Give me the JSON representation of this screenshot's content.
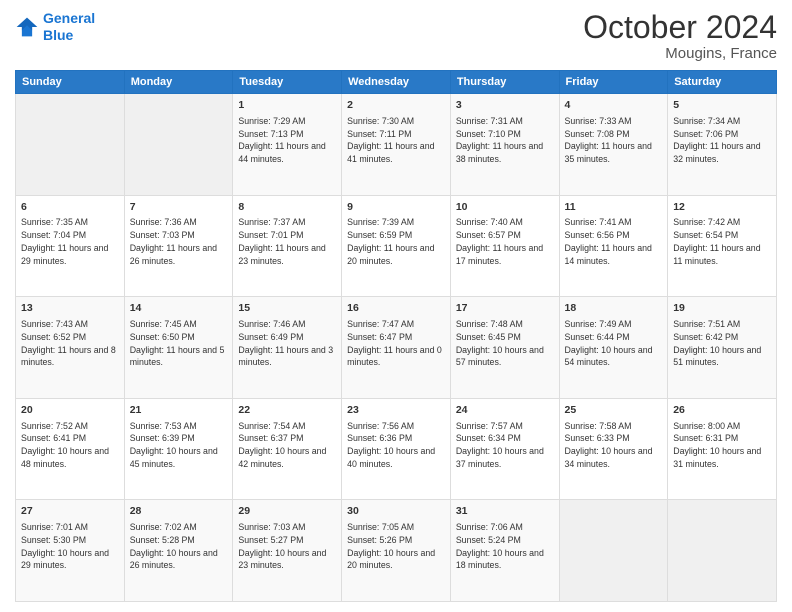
{
  "header": {
    "logo_line1": "General",
    "logo_line2": "Blue",
    "month": "October 2024",
    "location": "Mougins, France"
  },
  "days_of_week": [
    "Sunday",
    "Monday",
    "Tuesday",
    "Wednesday",
    "Thursday",
    "Friday",
    "Saturday"
  ],
  "weeks": [
    [
      {
        "day": "",
        "info": ""
      },
      {
        "day": "",
        "info": ""
      },
      {
        "day": "1",
        "info": "Sunrise: 7:29 AM\nSunset: 7:13 PM\nDaylight: 11 hours and 44 minutes."
      },
      {
        "day": "2",
        "info": "Sunrise: 7:30 AM\nSunset: 7:11 PM\nDaylight: 11 hours and 41 minutes."
      },
      {
        "day": "3",
        "info": "Sunrise: 7:31 AM\nSunset: 7:10 PM\nDaylight: 11 hours and 38 minutes."
      },
      {
        "day": "4",
        "info": "Sunrise: 7:33 AM\nSunset: 7:08 PM\nDaylight: 11 hours and 35 minutes."
      },
      {
        "day": "5",
        "info": "Sunrise: 7:34 AM\nSunset: 7:06 PM\nDaylight: 11 hours and 32 minutes."
      }
    ],
    [
      {
        "day": "6",
        "info": "Sunrise: 7:35 AM\nSunset: 7:04 PM\nDaylight: 11 hours and 29 minutes."
      },
      {
        "day": "7",
        "info": "Sunrise: 7:36 AM\nSunset: 7:03 PM\nDaylight: 11 hours and 26 minutes."
      },
      {
        "day": "8",
        "info": "Sunrise: 7:37 AM\nSunset: 7:01 PM\nDaylight: 11 hours and 23 minutes."
      },
      {
        "day": "9",
        "info": "Sunrise: 7:39 AM\nSunset: 6:59 PM\nDaylight: 11 hours and 20 minutes."
      },
      {
        "day": "10",
        "info": "Sunrise: 7:40 AM\nSunset: 6:57 PM\nDaylight: 11 hours and 17 minutes."
      },
      {
        "day": "11",
        "info": "Sunrise: 7:41 AM\nSunset: 6:56 PM\nDaylight: 11 hours and 14 minutes."
      },
      {
        "day": "12",
        "info": "Sunrise: 7:42 AM\nSunset: 6:54 PM\nDaylight: 11 hours and 11 minutes."
      }
    ],
    [
      {
        "day": "13",
        "info": "Sunrise: 7:43 AM\nSunset: 6:52 PM\nDaylight: 11 hours and 8 minutes."
      },
      {
        "day": "14",
        "info": "Sunrise: 7:45 AM\nSunset: 6:50 PM\nDaylight: 11 hours and 5 minutes."
      },
      {
        "day": "15",
        "info": "Sunrise: 7:46 AM\nSunset: 6:49 PM\nDaylight: 11 hours and 3 minutes."
      },
      {
        "day": "16",
        "info": "Sunrise: 7:47 AM\nSunset: 6:47 PM\nDaylight: 11 hours and 0 minutes."
      },
      {
        "day": "17",
        "info": "Sunrise: 7:48 AM\nSunset: 6:45 PM\nDaylight: 10 hours and 57 minutes."
      },
      {
        "day": "18",
        "info": "Sunrise: 7:49 AM\nSunset: 6:44 PM\nDaylight: 10 hours and 54 minutes."
      },
      {
        "day": "19",
        "info": "Sunrise: 7:51 AM\nSunset: 6:42 PM\nDaylight: 10 hours and 51 minutes."
      }
    ],
    [
      {
        "day": "20",
        "info": "Sunrise: 7:52 AM\nSunset: 6:41 PM\nDaylight: 10 hours and 48 minutes."
      },
      {
        "day": "21",
        "info": "Sunrise: 7:53 AM\nSunset: 6:39 PM\nDaylight: 10 hours and 45 minutes."
      },
      {
        "day": "22",
        "info": "Sunrise: 7:54 AM\nSunset: 6:37 PM\nDaylight: 10 hours and 42 minutes."
      },
      {
        "day": "23",
        "info": "Sunrise: 7:56 AM\nSunset: 6:36 PM\nDaylight: 10 hours and 40 minutes."
      },
      {
        "day": "24",
        "info": "Sunrise: 7:57 AM\nSunset: 6:34 PM\nDaylight: 10 hours and 37 minutes."
      },
      {
        "day": "25",
        "info": "Sunrise: 7:58 AM\nSunset: 6:33 PM\nDaylight: 10 hours and 34 minutes."
      },
      {
        "day": "26",
        "info": "Sunrise: 8:00 AM\nSunset: 6:31 PM\nDaylight: 10 hours and 31 minutes."
      }
    ],
    [
      {
        "day": "27",
        "info": "Sunrise: 7:01 AM\nSunset: 5:30 PM\nDaylight: 10 hours and 29 minutes."
      },
      {
        "day": "28",
        "info": "Sunrise: 7:02 AM\nSunset: 5:28 PM\nDaylight: 10 hours and 26 minutes."
      },
      {
        "day": "29",
        "info": "Sunrise: 7:03 AM\nSunset: 5:27 PM\nDaylight: 10 hours and 23 minutes."
      },
      {
        "day": "30",
        "info": "Sunrise: 7:05 AM\nSunset: 5:26 PM\nDaylight: 10 hours and 20 minutes."
      },
      {
        "day": "31",
        "info": "Sunrise: 7:06 AM\nSunset: 5:24 PM\nDaylight: 10 hours and 18 minutes."
      },
      {
        "day": "",
        "info": ""
      },
      {
        "day": "",
        "info": ""
      }
    ]
  ]
}
